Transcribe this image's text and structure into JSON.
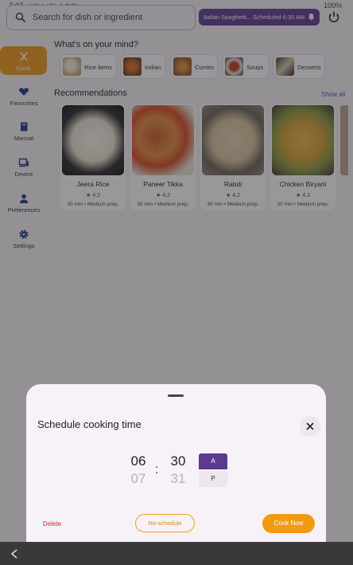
{
  "status_bar": {
    "time": "5:07",
    "date": "3월 26일 수요일",
    "battery": "100%"
  },
  "search": {
    "placeholder": "Search for dish or ingredient",
    "icon": "search-icon"
  },
  "schedule_pill": {
    "text": "Italian Spaghetti... Scheduled 6:30 AM",
    "icon": "bell-icon"
  },
  "power": {
    "icon": "power-icon"
  },
  "sidebar": {
    "items": [
      {
        "label": "Cook",
        "icon": "chef-utensils-icon",
        "active": true
      },
      {
        "label": "Favourites",
        "icon": "heart-icon"
      },
      {
        "label": "Manual",
        "icon": "book-icon"
      },
      {
        "label": "Device",
        "icon": "devices-icon"
      },
      {
        "label": "Preferences",
        "icon": "person-icon"
      },
      {
        "label": "Settings",
        "icon": "gear-icon"
      }
    ]
  },
  "mind": {
    "title": "What's on your mind?",
    "chips": [
      {
        "label": "Rice items"
      },
      {
        "label": "Indian"
      },
      {
        "label": "Curries"
      },
      {
        "label": "Soups"
      },
      {
        "label": "Desserts"
      }
    ]
  },
  "recommendations": {
    "title": "Recommendations",
    "show_all": "Show all",
    "cards": [
      {
        "name": "Jeera Rice",
        "rating": "★ 4.2",
        "meta": "30 min • Medium prep."
      },
      {
        "name": "Paneer Tikka",
        "rating": "★ 4.2",
        "meta": "30 min • Medium prep."
      },
      {
        "name": "Rabdi",
        "rating": "★ 4.2",
        "meta": "30 min • Medium prep."
      },
      {
        "name": "Chicken Biryani",
        "rating": "★ 4.2",
        "meta": "30 min • Medium prep."
      }
    ]
  },
  "sheet": {
    "title": "Schedule cooking time",
    "close_icon": "close-icon",
    "hour": {
      "current": "06",
      "next": "07"
    },
    "minute": {
      "current": "30",
      "next": "31"
    },
    "separator": ":",
    "am_label": "A",
    "pm_label": "P",
    "selected_period": "A",
    "delete_label": "Delete",
    "reschedule_label": "Re-schedule",
    "cook_now_label": "Cook Now"
  },
  "navbar": {
    "back_icon": "back-chevron-icon"
  },
  "colors": {
    "accent_orange": "#f29b12",
    "primary_purple": "#5c3a91",
    "danger": "#d02a2a"
  }
}
